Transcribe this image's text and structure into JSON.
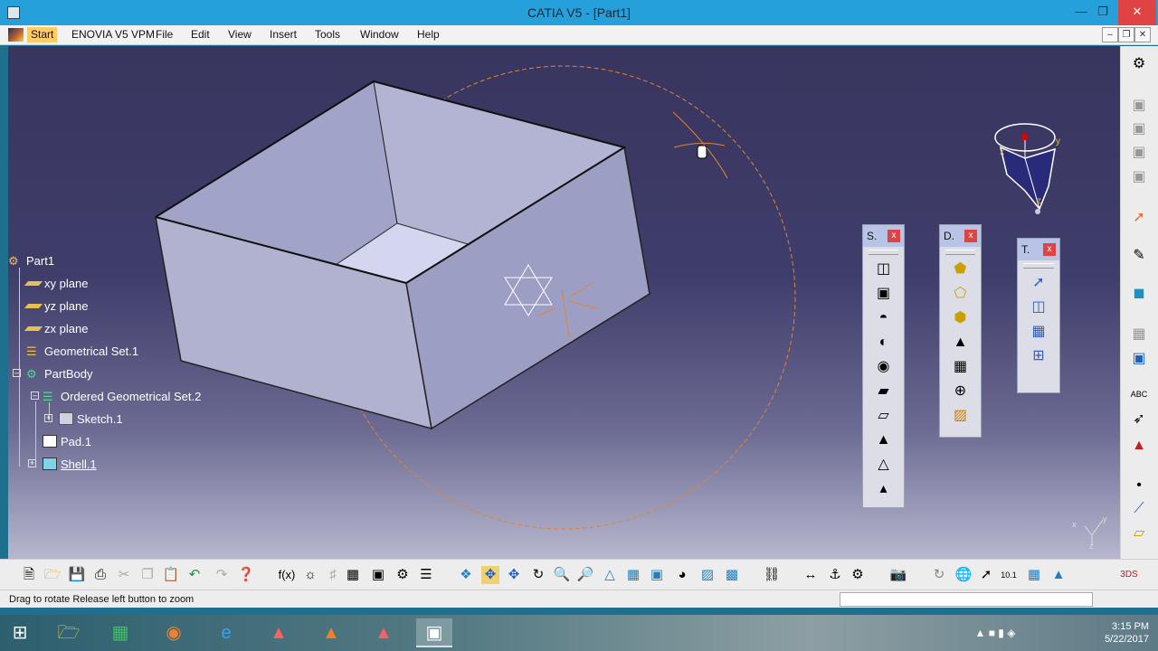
{
  "window": {
    "title": "CATIA V5 - [Part1]"
  },
  "menu": {
    "items": [
      "Start",
      "ENOVIA V5 VPM",
      "File",
      "Edit",
      "View",
      "Insert",
      "Tools",
      "Window",
      "Help"
    ]
  },
  "tree": {
    "nodes": [
      "Part1",
      "xy plane",
      "yz plane",
      "zx plane",
      "Geometrical Set.1",
      "PartBody",
      "Ordered Geometrical Set.2",
      "Sketch.1",
      "Pad.1",
      "Shell.1"
    ]
  },
  "compass": {
    "labels": {
      "x": "x",
      "y": "y",
      "z": "z"
    }
  },
  "floating_toolbars": [
    {
      "title": "S.",
      "close": "x",
      "icons": [
        "pad-icon",
        "pocket-icon",
        "shaft-icon",
        "groove-icon",
        "hole-icon",
        "rib-icon",
        "slot-icon",
        "stiffener-icon",
        "loft-icon",
        "remove-loft-icon"
      ]
    },
    {
      "title": "D.",
      "close": "x",
      "icons": [
        "edge-fillet-icon",
        "chamfer-icon",
        "draft-icon",
        "shell-icon",
        "thickness-icon",
        "thread-icon",
        "remove-face-icon"
      ]
    },
    {
      "title": "T.",
      "close": "x",
      "icons": [
        "translation-icon",
        "symmetry-icon",
        "pattern-icon",
        "scaling-icon"
      ]
    }
  ],
  "status": {
    "message": "Drag to rotate  Release left button to zoom"
  },
  "mini_axis": {
    "x": "x",
    "y": "y",
    "z": "z"
  },
  "taskbar": {
    "time": "3:15 PM",
    "date": "5/22/2017"
  },
  "colors": {
    "title_bar": "#26a0da",
    "viewport_top": "#38355f",
    "viewport_bottom": "#b7b7cf",
    "part_face": "#a9aad2",
    "rotation_circle": "#e0833a",
    "close_button": "#e04343"
  }
}
